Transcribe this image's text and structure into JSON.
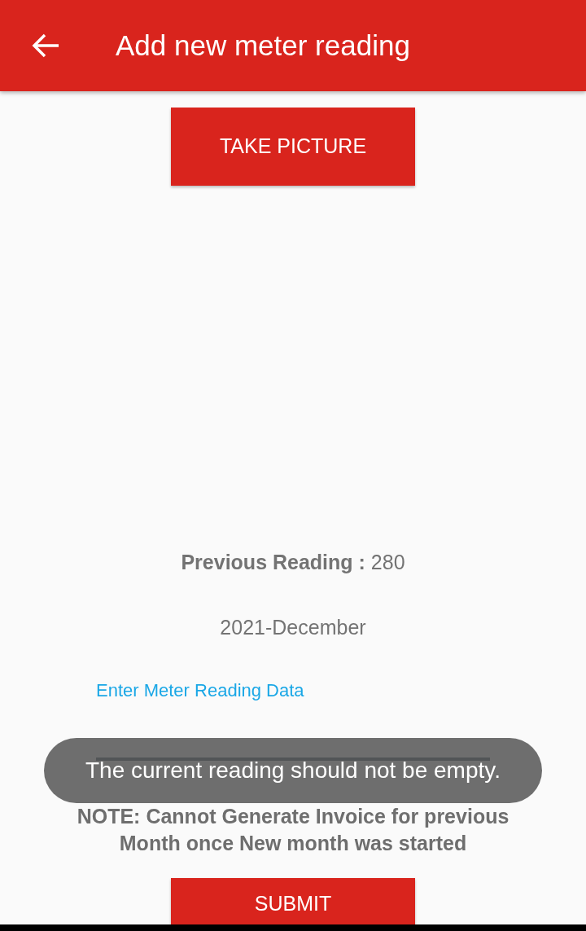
{
  "app_bar": {
    "title": "Add new meter reading"
  },
  "take_picture_button": {
    "label": "TAKE PICTURE"
  },
  "previous_reading": "**Previous Reading :** 280",
  "period": "2021-December",
  "reading_field": {
    "label": "Enter Meter Reading Data"
  },
  "note": "NOTE: Cannot Generate Invoice for previous Month once New month was started",
  "submit_button": {
    "label": "SUBMIT"
  },
  "toast": {
    "message": "The current reading should not be empty."
  }
}
